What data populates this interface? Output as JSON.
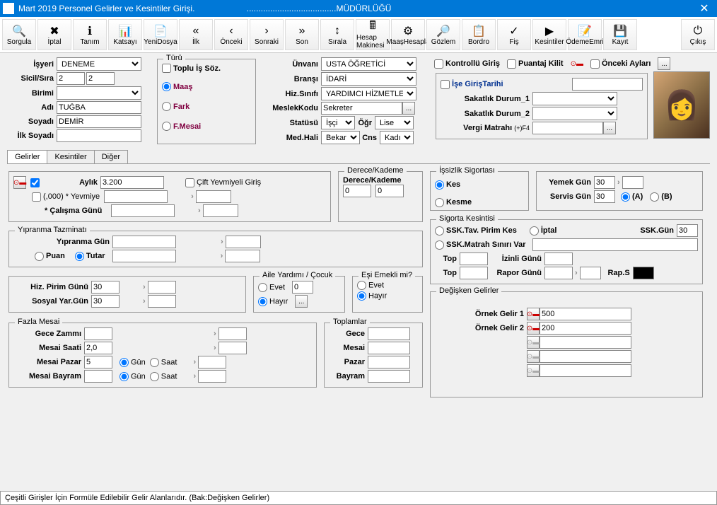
{
  "title": "Mart  2019 Personel Gelirler ve Kesintiler Girişi.",
  "titleSuffix": "......................................MÜDÜRLÜĞÜ",
  "toolbar": [
    {
      "label": "Sorgula",
      "icon": "🔍"
    },
    {
      "label": "İptal",
      "icon": "✖"
    },
    {
      "label": "Tanım",
      "icon": "ℹ"
    },
    {
      "label": "Katsayı",
      "icon": "📊"
    },
    {
      "label": "YeniDosya",
      "icon": "📄"
    },
    {
      "label": "İlk",
      "icon": "«"
    },
    {
      "label": "Önceki",
      "icon": "‹"
    },
    {
      "label": "Sonraki",
      "icon": "›"
    },
    {
      "label": "Son",
      "icon": "»"
    },
    {
      "label": "Sırala",
      "icon": "↕"
    },
    {
      "label": "Hesap Makinesi",
      "icon": "🖩"
    },
    {
      "label": "MaaşHesapla",
      "icon": "⚙"
    },
    {
      "label": "Gözlem",
      "icon": "🔎"
    },
    {
      "label": "Bordro",
      "icon": "📋"
    },
    {
      "label": "Fiş",
      "icon": "✓"
    },
    {
      "label": "Kesintiler",
      "icon": "▶"
    },
    {
      "label": "ÖdemeEmri",
      "icon": "📝"
    },
    {
      "label": "Kayıt",
      "icon": "💾"
    },
    {
      "label": "Çıkış",
      "icon": "⏻"
    }
  ],
  "header": {
    "isyeri": "İşyeri",
    "isyeriVal": "DENEME",
    "sicil": "Sicil/Sıra",
    "sicilVal1": "2",
    "sicilVal2": "2",
    "birimi": "Birimi",
    "adi": "Adı",
    "adiVal": "TUĞBA",
    "soyadi": "Soyadı",
    "soyadiVal": "DEMİR",
    "ilksoyadi": "İlk Soyadı",
    "turu": "Türü",
    "topluIs": "Toplu İş Söz.",
    "maas": "Maaş",
    "fark": "Fark",
    "fmesai": "F.Mesai",
    "unvani": "Ünvanı",
    "unvaniVal": "USTA ÖĞRETİCİ",
    "bransi": "Branşı",
    "bransiVal": "İDARİ",
    "hizSinifi": "Hiz.Sınıfı",
    "hizSinifiVal": "YARDIMCI HİZMETLER",
    "meslekKodu": "MeslekKodu",
    "meslekVal": "Sekreter",
    "statusu": "Statüsü",
    "statusVal": "İşçi",
    "ogr": "Öğr",
    "ogrVal": "Lise",
    "medHali": "Med.Hali",
    "medVal": "Bekar",
    "cns": "Cns",
    "cnsVal": "Kadın",
    "kontrolluGiris": "Kontrollü Giriş",
    "puantajKilit": "Puantaj Kilit",
    "oncekiAylar": "Önceki Ayları",
    "iseGiris": "İşe GirişTarihi",
    "sakatlik1": "Sakatlık Durum_1",
    "sakatlik2": "Sakatlık Durum_2",
    "vergiMatrahi": "Vergi Matrahı",
    "vergiHint": "(+)F4"
  },
  "tabs": {
    "gelirler": "Gelirler",
    "kesintiler": "Kesintiler",
    "diger": "Diğer"
  },
  "gelirler": {
    "aylik": "Aylık",
    "aylikVal": "3.200",
    "yevmiye": "(,000) * Yevmiye",
    "calisma": "* Çalışma Günü",
    "ciftYevmiye": "Çift Yevmiyeli Giriş",
    "dereceKademe": "Derece/Kademe",
    "dereceKademeBig": "Derece/Kademe",
    "d0": "0",
    "k0": "0",
    "issizlik": "İşsizlik Sigortası",
    "kes": "Kes",
    "kesme": "Kesme",
    "yemekGun": "Yemek Gün",
    "yemekVal": "30",
    "servisGun": "Servis Gün",
    "servisVal": "30",
    "a": "(A)",
    "b": "(B)",
    "yipranma": "Yıpranma Tazminatı",
    "yipranmaGun": "Yıpranma Gün",
    "puan": "Puan",
    "tutar": "Tutar",
    "sigortaKesintisi": "Sigorta Kesintisi",
    "sskTav": "SSK.Tav. Pirim Kes",
    "iptal": "İptal",
    "sskGun": "SSK.Gün",
    "sskGunVal": "30",
    "sskMatrah": "SSK.Matrah Sınırı Var",
    "top1": "Top",
    "izinli": "İzinli Günü",
    "top2": "Top",
    "rapor": "Rapor Günü",
    "rapS": "Rap.S",
    "hizPrim": "Hiz. Pirim Günü",
    "hizPrimVal": "30",
    "sosyalYar": "Sosyal Yar.Gün",
    "sosyalYarVal": "30",
    "aileYardimi": "Aile Yardımı  /  Çocuk",
    "evet": "Evet",
    "hayir": "Hayır",
    "cocukVal": "0",
    "esiEmekli": "Eşi Emekli mi?",
    "degisken": "Değişken Gelirler",
    "ornek1": "Örnek Gelir 1",
    "ornek1Val": "500",
    "ornek2": "Örnek Gelir 2",
    "ornek2Val": "200",
    "fazlaMesai": "Fazla Mesai",
    "geceZammi": "Gece Zammı",
    "mesaiSaati": "Mesai Saati",
    "mesaiSaatiVal": "2,0",
    "mesaiPazar": "Mesai Pazar",
    "mesaiPazarVal": "5",
    "mesaiBayram": "Mesai Bayram",
    "gun": "Gün",
    "saat": "Saat",
    "toplamlar": "Toplamlar",
    "gece": "Gece",
    "mesai": "Mesai",
    "pazar": "Pazar",
    "bayram": "Bayram"
  },
  "statusbar": "Çeşitli Girişler İçin Formüle Edilebilir Gelir Alanlarıdır. (Bak:Değişken Gelirler)"
}
